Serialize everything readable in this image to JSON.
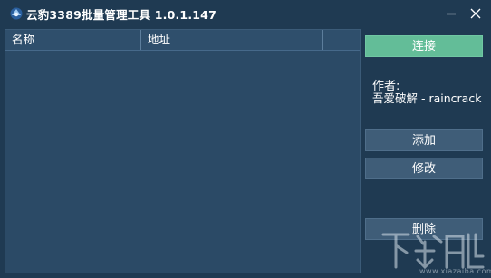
{
  "window": {
    "title": "云豹3389批量管理工具 1.0.1.147",
    "icons": {
      "app": "app-logo-icon",
      "minimize": "minimize-icon",
      "close": "close-icon"
    }
  },
  "list": {
    "columns": [
      "名称",
      "地址",
      ""
    ],
    "rows": []
  },
  "buttons": {
    "connect": "连接",
    "add": "添加",
    "edit": "修改",
    "delete": "删除"
  },
  "author": {
    "label": "作者:",
    "value": "吾爱破解 - raincrack"
  },
  "watermark": {
    "logo": "下载吧",
    "url": "www.xiazaiba.com"
  },
  "colors": {
    "background": "#1f3a52",
    "list_background": "#2b4a66",
    "button": "#3f5d78",
    "connect_button": "#63bd98"
  }
}
